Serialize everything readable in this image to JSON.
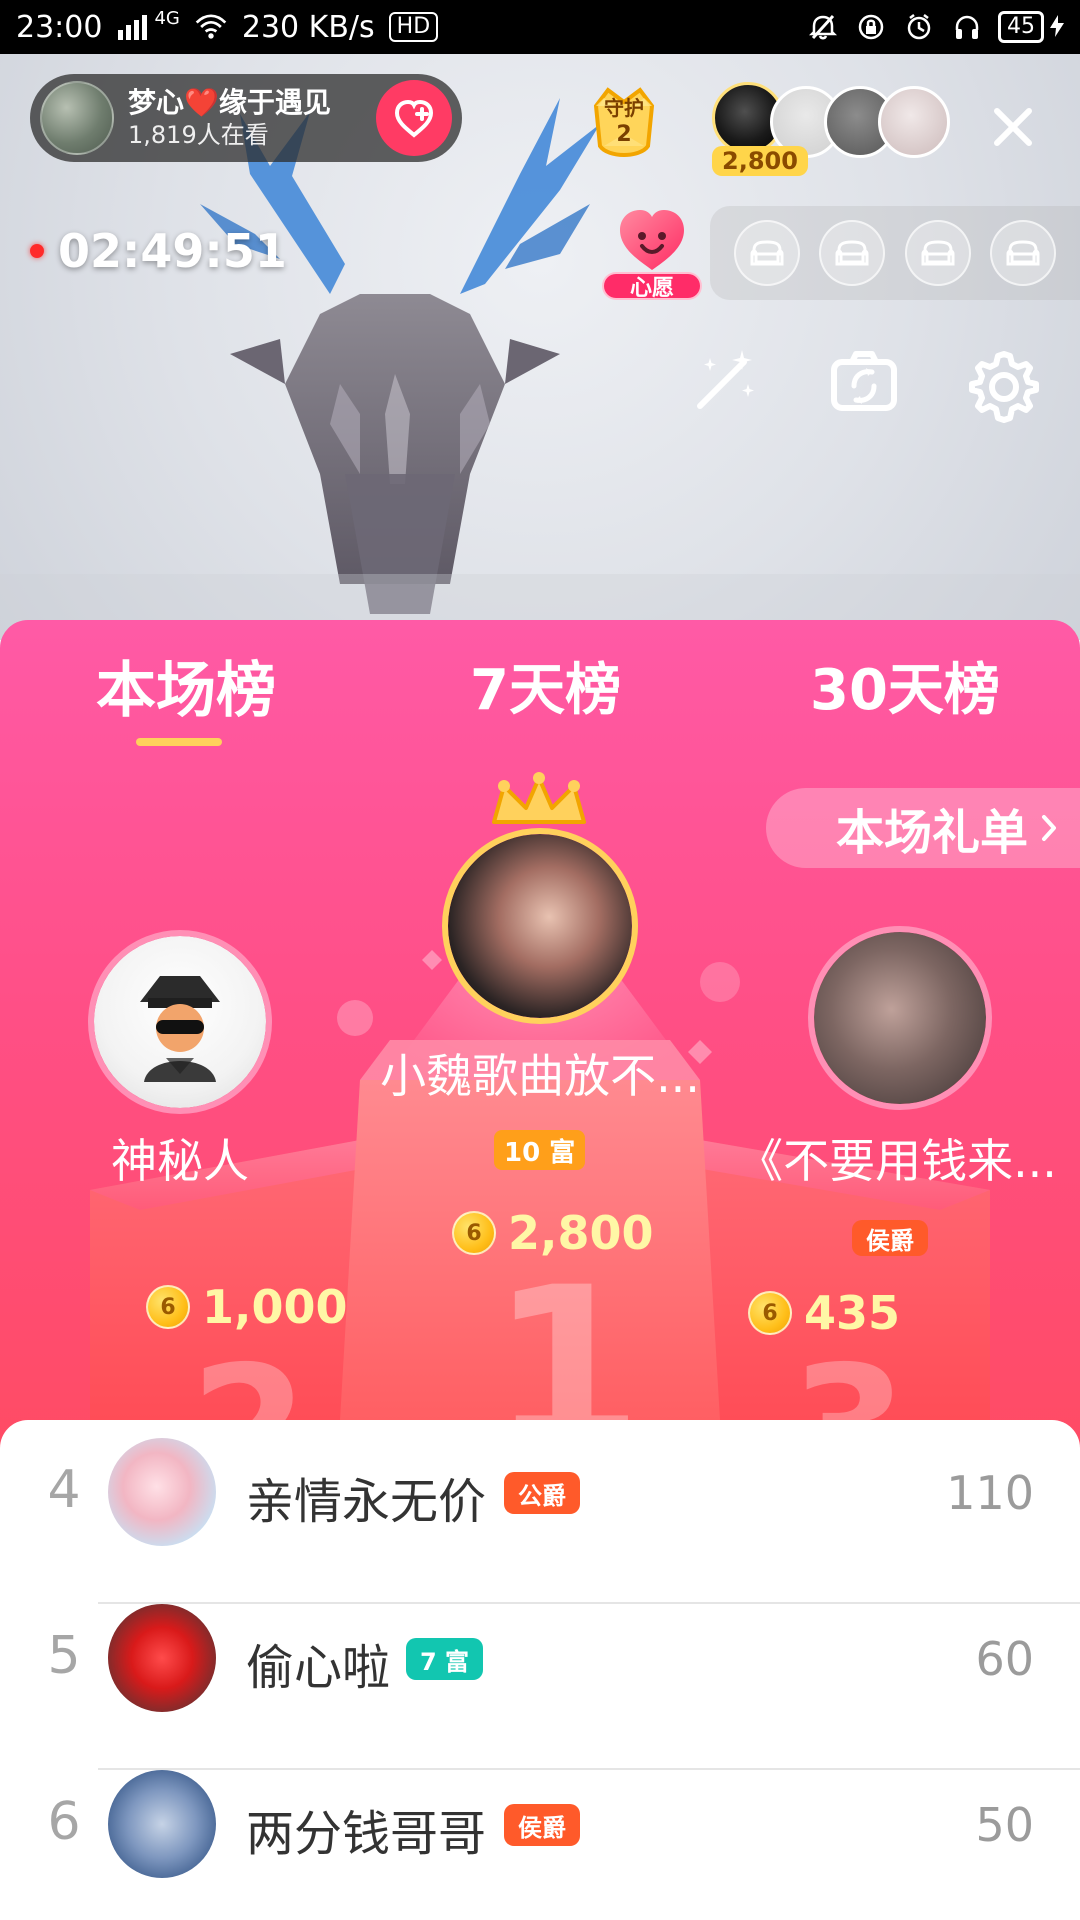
{
  "status_bar": {
    "time": "23:00",
    "network": "4G",
    "speed": "230 KB/s",
    "hd": "HD",
    "battery": "45"
  },
  "room": {
    "host_name": "梦心❤️缘于遇见",
    "viewers": "1,819人在看",
    "guard_label": "守护",
    "guard_count": "2",
    "top_contribution": "2,800",
    "live_time": "02:49:51",
    "wish_label": "心愿"
  },
  "tabs": [
    {
      "label": "本场榜"
    },
    {
      "label": "7天榜"
    },
    {
      "label": "30天榜"
    }
  ],
  "gift_list_button": "本场礼单",
  "podium": {
    "first": {
      "name": "小魏歌曲放不...",
      "rich_level": "10 富",
      "coins": "2,800",
      "rank_mark": "1"
    },
    "second": {
      "name": "神秘人",
      "coins": "1,000",
      "rank_mark": "2"
    },
    "third": {
      "name": "《不要用钱来...",
      "title": "侯爵",
      "coins": "435",
      "rank_mark": "3"
    }
  },
  "ranking_list": [
    {
      "rank": "4",
      "name": "亲情永无价",
      "badge": "公爵",
      "badge_color": "#ff5a2a",
      "score": "110"
    },
    {
      "rank": "5",
      "name": "偷心啦",
      "badge": "7 富",
      "badge_color": "#12c6b0",
      "score": "60"
    },
    {
      "rank": "6",
      "name": "两分钱哥哥",
      "badge": "侯爵",
      "badge_color": "#ff5a2a",
      "score": "50"
    }
  ]
}
